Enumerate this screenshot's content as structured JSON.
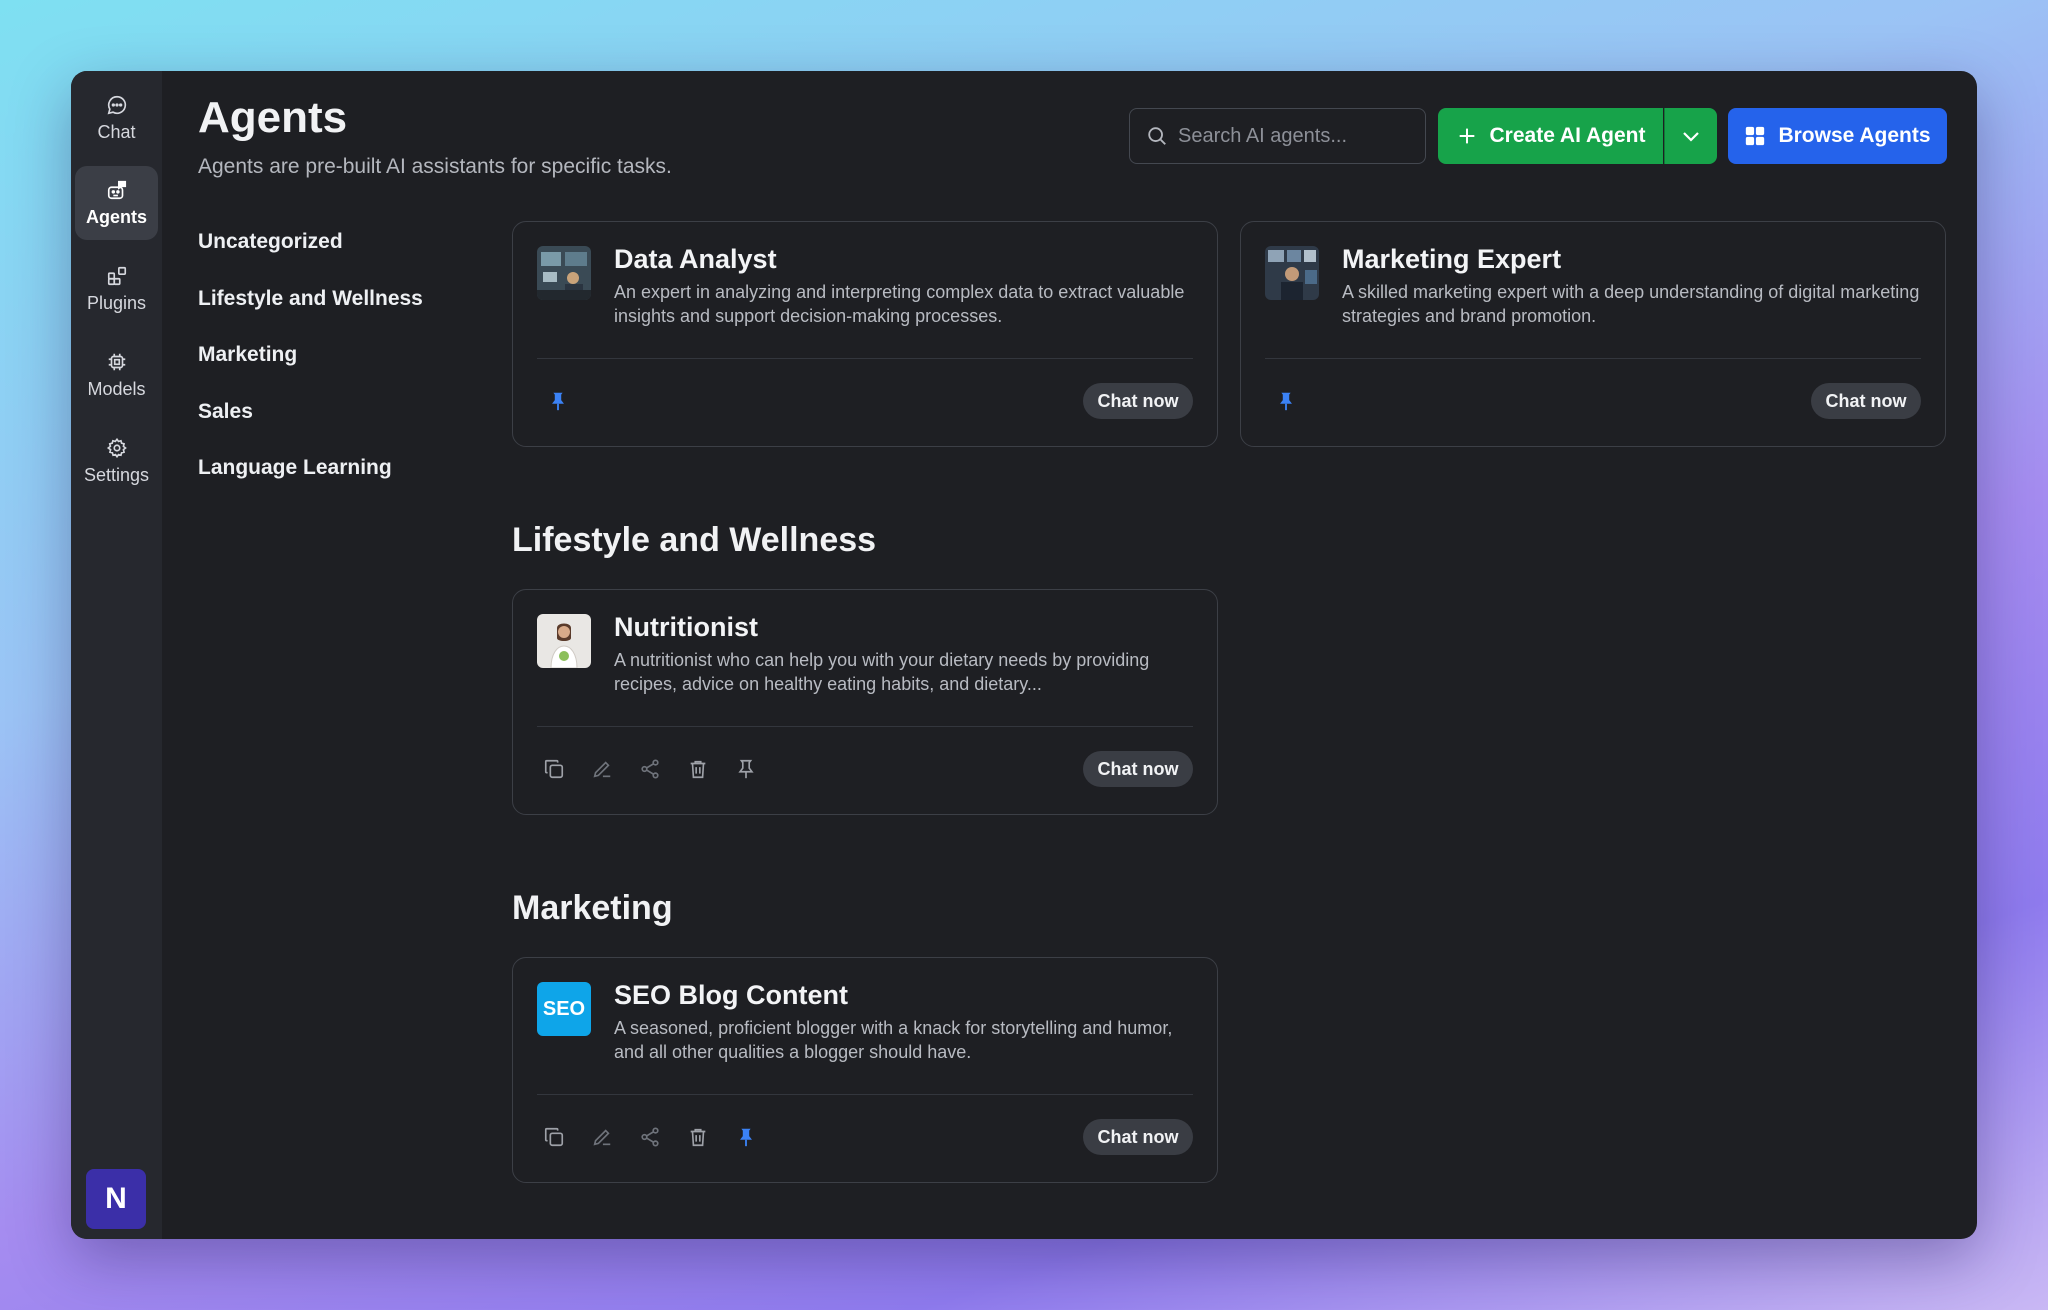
{
  "rail": {
    "items": [
      {
        "label": "Chat",
        "icon": "chat-icon"
      },
      {
        "label": "Agents",
        "icon": "agents-icon",
        "active": true
      },
      {
        "label": "Plugins",
        "icon": "plugins-icon"
      },
      {
        "label": "Models",
        "icon": "models-icon"
      },
      {
        "label": "Settings",
        "icon": "gear-icon"
      }
    ],
    "avatar_letter": "N"
  },
  "header": {
    "title": "Agents",
    "subtitle": "Agents are pre-built AI assistants for specific tasks.",
    "search_placeholder": "Search AI agents...",
    "create_label": "Create AI Agent",
    "browse_label": "Browse Agents"
  },
  "categories": [
    "Uncategorized",
    "Lifestyle and Wellness",
    "Marketing",
    "Sales",
    "Language Learning"
  ],
  "sections": [
    {
      "title": "",
      "agents": [
        {
          "name": "Data Analyst",
          "description": "An expert in analyzing and interpreting complex data to extract valuable insights and support decision-making processes.",
          "chat_label": "Chat now",
          "pinned": true,
          "show_actions": false
        },
        {
          "name": "Marketing Expert",
          "description": "A skilled marketing expert with a deep understanding of digital marketing strategies and brand promotion.",
          "chat_label": "Chat now",
          "pinned": true,
          "show_actions": false
        }
      ]
    },
    {
      "title": "Lifestyle and Wellness",
      "agents": [
        {
          "name": "Nutritionist",
          "description": "A nutritionist who can help you with your dietary needs by providing recipes, advice on healthy eating habits, and dietary...",
          "chat_label": "Chat now",
          "pinned": false,
          "show_actions": true
        }
      ]
    },
    {
      "title": "Marketing",
      "agents": [
        {
          "name": "SEO Blog Content",
          "thumb_text": "SEO",
          "description": "A seasoned, proficient blogger with a knack for storytelling and humor, and all other qualities a blogger should have.",
          "chat_label": "Chat now",
          "pinned": true,
          "show_actions": true
        }
      ]
    }
  ],
  "colors": {
    "create_button": "#17a34a",
    "browse_button": "#2563eb",
    "pin_active": "#3b82f6",
    "seo_thumb": "#0ea5e9"
  }
}
